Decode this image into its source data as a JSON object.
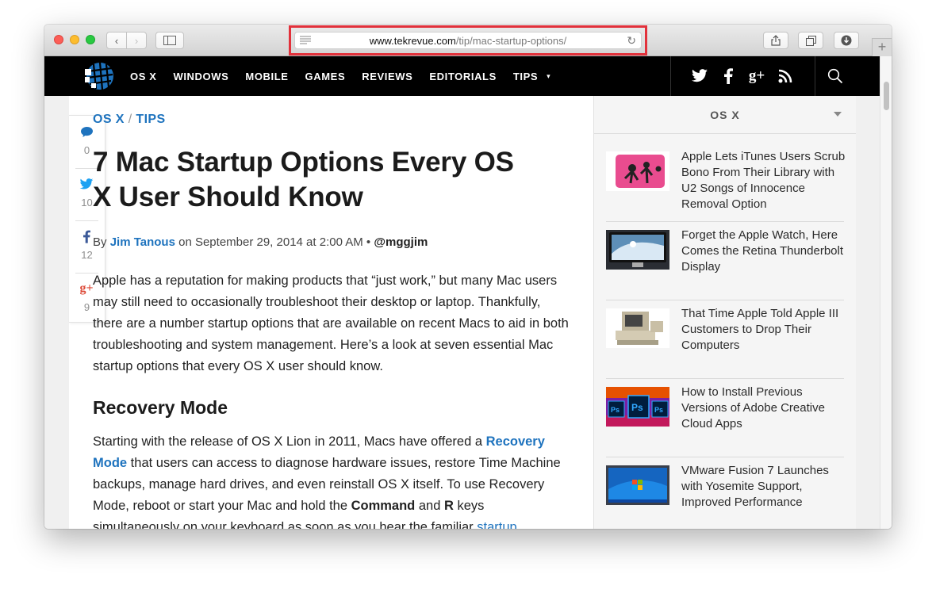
{
  "browser": {
    "url_host": "www.tekrevue.com",
    "url_path": "/tip/mac-startup-options/",
    "new_tab_label": "+"
  },
  "site_nav": {
    "items": [
      "OS X",
      "WINDOWS",
      "MOBILE",
      "GAMES",
      "REVIEWS",
      "EDITORIALS",
      "TIPS"
    ],
    "tips_caret": "▾",
    "social_icons": [
      "twitter-icon",
      "facebook-icon",
      "google-plus-icon",
      "rss-icon"
    ]
  },
  "share_rail": [
    {
      "icon": "comment-icon",
      "count": "0",
      "color": "#1e73be"
    },
    {
      "icon": "twitter-icon",
      "count": "10",
      "color": "#1da1f2"
    },
    {
      "icon": "facebook-icon",
      "count": "12",
      "color": "#3b5998"
    },
    {
      "icon": "google-plus-icon",
      "count": "9",
      "color": "#dd4b39"
    }
  ],
  "article": {
    "crumb_1": "OS X",
    "crumb_sep": " / ",
    "crumb_2": "TIPS",
    "title": "7 Mac Startup Options Every OS X User Should Know",
    "by_prefix": "By ",
    "author": "Jim Tanous",
    "by_middle": " on September 29, 2014 at 2:00 AM • ",
    "handle": "@mggjim",
    "intro": "Apple has a reputation for making products that “just work,” but many Mac users may still need to occasionally troubleshoot their desktop or laptop. Thankfully, there are a number startup options that are available on recent Macs to aid in both troubleshooting and system management. Here’s a look at seven essential Mac startup options that every OS X user should know.",
    "h2": "Recovery Mode",
    "p2_a": "Starting with the release of OS X Lion in 2011, Macs have offered a ",
    "p2_link": "Recovery Mode",
    "p2_b": " that users can access to diagnose hardware issues, restore Time Machine backups, manage hard drives, and even reinstall OS X itself. To use Recovery Mode, reboot or start your Mac and hold the ",
    "p2_cmd": "Command",
    "p2_and": " and ",
    "p2_r": "R",
    "p2_c": " keys simultaneously on your keyboard as soon as you hear the familiar ",
    "p2_link2": "startup"
  },
  "sidebar": {
    "heading": "OS X",
    "posts": [
      {
        "title": "Apple Lets iTunes Users Scrub Bono From Their Library with U2 Songs of Innocence Removal Option"
      },
      {
        "title": "Forget the Apple Watch, Here Comes the Retina Thunderbolt Display"
      },
      {
        "title": "That Time Apple Told Apple III Customers to Drop Their Computers"
      },
      {
        "title": "How to Install Previous Versions of Adobe Creative Cloud Apps"
      },
      {
        "title": "VMware Fusion 7 Launches with Yosemite Support, Improved Performance"
      }
    ],
    "ps_label": "Ps"
  }
}
